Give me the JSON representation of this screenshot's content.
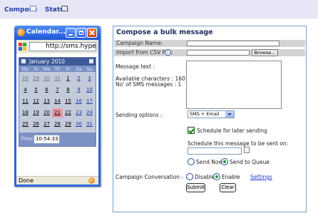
{
  "nav": {
    "compose": "Compose",
    "status": "Status"
  },
  "mini_window": {
    "title": "Calendar...",
    "address": "http://sms.hype",
    "status": "Done"
  },
  "calendar": {
    "month": "January 2010",
    "weekdays": [
      "Mo",
      "Tu",
      "We",
      "Th",
      "Fr",
      "Sa",
      "Su"
    ],
    "weeks": [
      [
        "28",
        "29",
        "30",
        "31",
        "1",
        "2",
        "3"
      ],
      [
        "4",
        "5",
        "6",
        "7",
        "8",
        "9",
        "10"
      ],
      [
        "11",
        "12",
        "13",
        "14",
        "15",
        "16",
        "17"
      ],
      [
        "18",
        "19",
        "20",
        "21",
        "22",
        "23",
        "24"
      ],
      [
        "25",
        "26",
        "27",
        "28",
        "29",
        "30",
        "31"
      ]
    ],
    "today": "21",
    "time_label": "Time:",
    "time_value": "10:54:33"
  },
  "form": {
    "title": "Compose a bulk message",
    "campaign_name_label": "Campaign Name:",
    "csv_label": "Import from CSV File:",
    "info_glyph": "i",
    "browse_label": "Browse...",
    "message_label": "Message text :",
    "available_chars": "Available characters : 160",
    "sms_count": "No' of SMS messages : 1",
    "sending_options_label": "Sending options :",
    "sending_option_value": "SMS + Email",
    "schedule_label": "Schedule for later sending",
    "schedule_time_label": "Schedule this message to be sent on:",
    "send_now_label": "Send Now",
    "send_queue_label": "Send to Queue",
    "conversation_label": "Campaign Conversation :",
    "disable_label": "Disable",
    "enable_label": "Enable",
    "settings_link": "Settings",
    "submit_label": "Submit",
    "clear_label": "Clear"
  },
  "colors": {
    "nav_bg": "#e6e6f6",
    "title_bar_blue": "#2f66d8",
    "calendar_today": "#e69aa6",
    "form_border": "#7aa0c8",
    "link": "#1e36c8"
  }
}
